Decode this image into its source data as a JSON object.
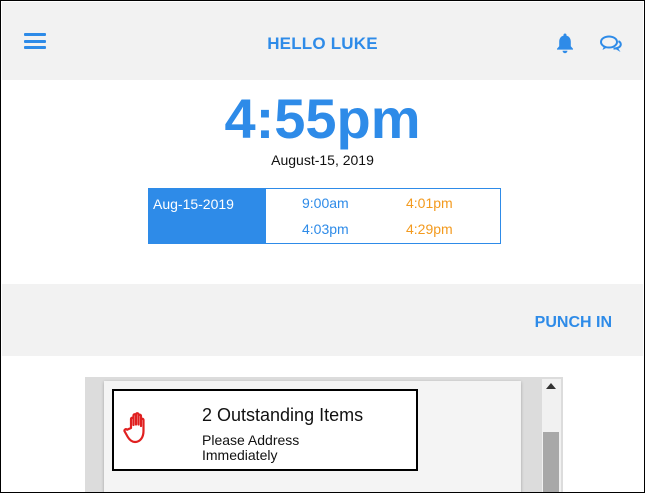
{
  "header": {
    "title": "HELLO LUKE",
    "menu_icon": "hamburger-menu-icon",
    "notification_icon": "bell-icon",
    "chat_icon": "chat-bubbles-icon"
  },
  "clock": {
    "time": "4:55pm",
    "date": "August-15, 2019"
  },
  "punch_log": {
    "date": "Aug-15-2019",
    "rows": [
      {
        "in": "9:00am",
        "out": "4:01pm"
      },
      {
        "in": "4:03pm",
        "out": "4:29pm"
      }
    ]
  },
  "actions": {
    "punch_in_label": "PUNCH IN"
  },
  "alerts": {
    "title": "2 Outstanding Items",
    "subtitle": "Please Address Immediately",
    "icon": "stop-hand-icon"
  },
  "colors": {
    "accent": "#2e8be8",
    "punch_out": "#f39a1e",
    "alert_icon": "#e02020"
  }
}
